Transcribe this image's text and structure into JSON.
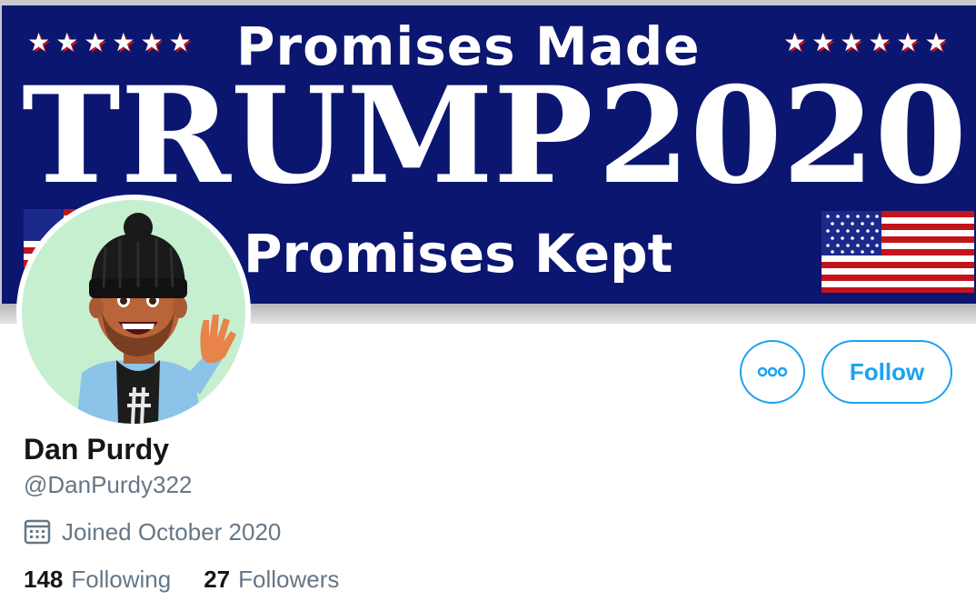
{
  "banner": {
    "stars_left": "★★★★★★",
    "stars_right": "★★★★★★",
    "top_text": "Promises Made",
    "headline_left": "TRUMP",
    "headline_right": "2020",
    "bottom_text": "Promises Kept"
  },
  "actions": {
    "more_icon": "more-horizontal-icon",
    "follow_label": "Follow"
  },
  "profile": {
    "name": "Dan Purdy",
    "handle": "@DanPurdy322",
    "joined_icon": "calendar-icon",
    "joined": "Joined October 2020",
    "following_count": "148",
    "following_label": "Following",
    "followers_count": "27",
    "followers_label": "Followers"
  },
  "colors": {
    "accent": "#1da1f2",
    "banner_navy": "#0b1670",
    "flag_red": "#c2141d",
    "secondary_text": "#657786",
    "avatar_bg": "#c6efd0"
  }
}
